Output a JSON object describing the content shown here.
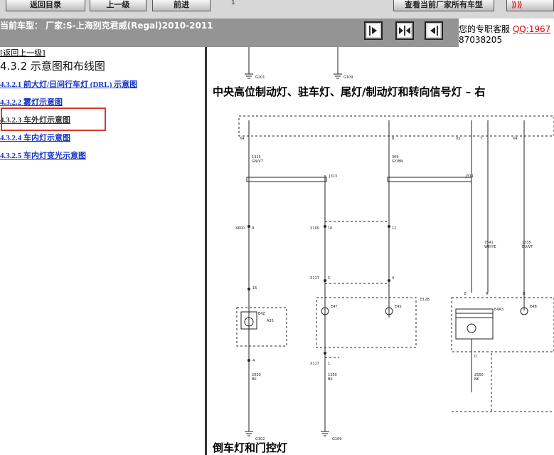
{
  "toolbar": {
    "buttons": [
      "返回目录",
      "上一级",
      "前进",
      "查看当前厂家所有车型"
    ],
    "tab_marker": "1"
  },
  "model_bar": {
    "label": "当前车型： 厂家:S-上海别克君威(Regal)2010-2011"
  },
  "nav_icons": [
    "expand-left-icon",
    "fit-icon",
    "collapse-right-icon"
  ],
  "service": {
    "text": "您的专职客服 ",
    "qq": "QQ:1967",
    "phone": "87038205"
  },
  "left_panel": {
    "back_link": "[返回上一级]",
    "section_title": "4.3.2 示意图和布线图",
    "items": [
      "4.3.2.1 前大灯/日间行车灯 (DRL) 示意图",
      "4.3.2.2 雾灯示意图",
      "4.3.2.3 车外灯示意图",
      "4.3.2.4 车内灯示意图",
      "4.3.2.5 车内灯变光示意图"
    ],
    "selected_index": 2,
    "highlight_color": "#e0342e"
  },
  "diagram": {
    "title_main": "中央高位制动灯、驻车灯、尾灯/制动灯和转向信号灯 – 右",
    "title_next": "倒车灯和门控灯",
    "grounds_top": [
      "G201",
      "G109"
    ],
    "grounds_bottom": [
      "G302",
      "G109"
    ],
    "connectors": [
      "X4",
      "X5",
      "X4",
      "J313",
      "J311",
      "X600",
      "X100",
      "X117",
      "X117"
    ],
    "pins": [
      "9",
      "10",
      "12",
      "5",
      "4",
      "16",
      "1",
      "4",
      "7",
      "E",
      "A",
      "B",
      "D",
      "8"
    ],
    "wires": [
      {
        "circuit": "1315",
        "color": "GN/VT"
      },
      {
        "circuit": "309",
        "color": "GY/BN"
      },
      {
        "circuit": "7541",
        "color": "WH/YE"
      },
      {
        "circuit": "1335",
        "color": "BU/VT"
      },
      {
        "circuit": "2050",
        "color": "BK"
      },
      {
        "circuit": "1350",
        "color": "BK"
      },
      {
        "circuit": "2550",
        "color": "BK"
      }
    ],
    "components": [
      "A35",
      "E4Z",
      "E4Y",
      "E4S",
      "E12B",
      "E4A3",
      "E4B"
    ]
  }
}
